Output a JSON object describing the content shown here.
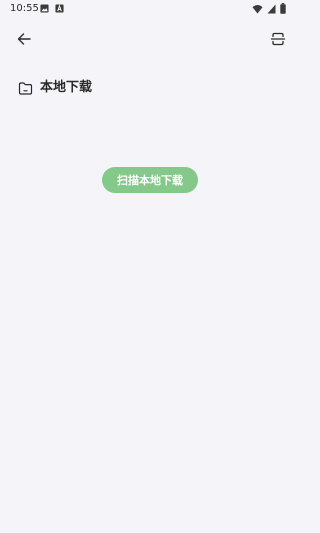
{
  "status_bar": {
    "time": "10:55",
    "left_icons": [
      "gallery-icon",
      "notification-a-icon"
    ],
    "right_icons": [
      "wifi-icon",
      "signal-icon",
      "battery-icon"
    ]
  },
  "toolbar": {
    "back_icon": "back-arrow-icon",
    "action_icon": "scan-icon"
  },
  "section": {
    "icon": "folder-icon",
    "title": "本地下载"
  },
  "main": {
    "scan_button_label": "扫描本地下载"
  },
  "colors": {
    "background": "#f5f4f9",
    "accent": "#85c98a",
    "text": "#2a2a2a"
  }
}
